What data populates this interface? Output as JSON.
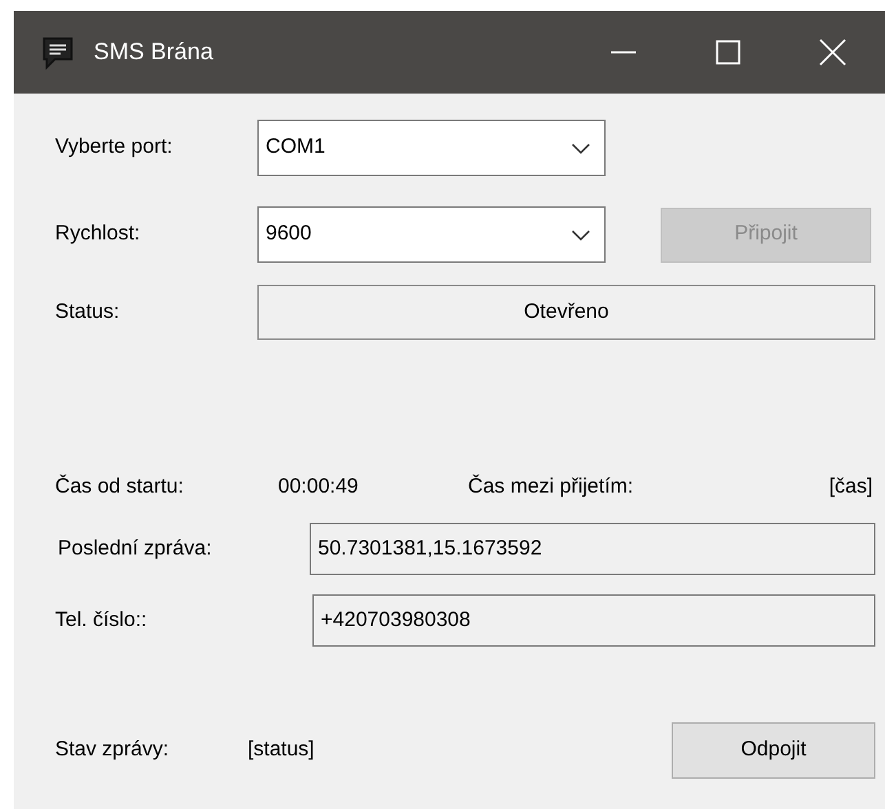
{
  "window": {
    "title": "SMS Brána"
  },
  "port": {
    "label": "Vyberte port:",
    "value": "COM1"
  },
  "speed": {
    "label": "Rychlost:",
    "value": "9600"
  },
  "connect_button": {
    "label": "Připojit",
    "disabled": true
  },
  "status": {
    "label": "Status:",
    "value": "Otevřeno"
  },
  "uptime": {
    "label": "Čas od startu:",
    "value": "00:00:49"
  },
  "interval": {
    "label": "Čas mezi přijetím:",
    "value": "[čas]"
  },
  "last_message": {
    "label": "Poslední zpráva:",
    "value": "50.7301381,15.1673592"
  },
  "phone": {
    "label": "Tel. číslo::",
    "value": "+420703980308"
  },
  "message_state": {
    "label": "Stav zprávy:",
    "value": "[status]"
  },
  "disconnect_button": {
    "label": "Odpojit",
    "disabled": false
  }
}
